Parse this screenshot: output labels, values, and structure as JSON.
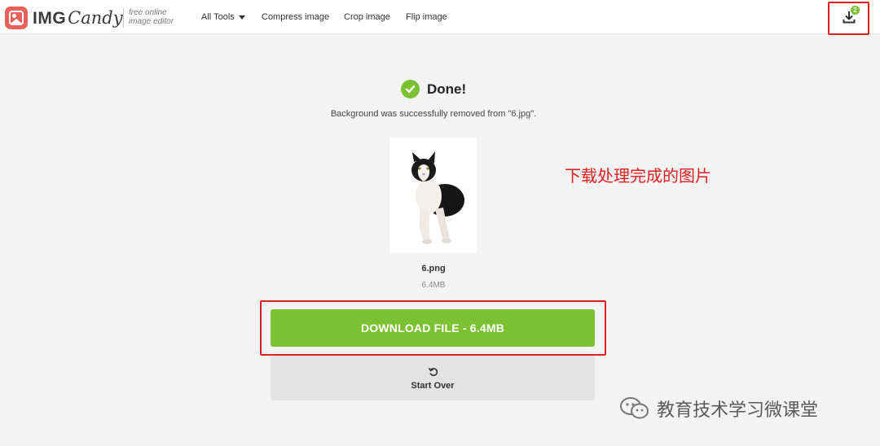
{
  "header": {
    "logo_img": "IMG",
    "logo_candy": "Candy",
    "tagline_line1": "free online",
    "tagline_line2": "image editor",
    "nav": {
      "all_tools": "All Tools",
      "compress": "Compress image",
      "crop": "Crop image",
      "flip": "Flip image"
    },
    "download_icon": "download-icon",
    "download_badge": "2"
  },
  "main": {
    "done_title": "Done!",
    "done_message": "Background was successfully removed from \"6.jpg\".",
    "file_name": "6.png",
    "file_size": "6.4MB",
    "download_button": "DOWNLOAD FILE - 6.4MB",
    "start_over": "Start Over"
  },
  "annotation": "下载处理完成的图片",
  "watermark": "教育技术学习微课堂",
  "colors": {
    "accent_green": "#7cc132",
    "highlight_red": "#e02020",
    "logo_red": "#e8625a"
  }
}
